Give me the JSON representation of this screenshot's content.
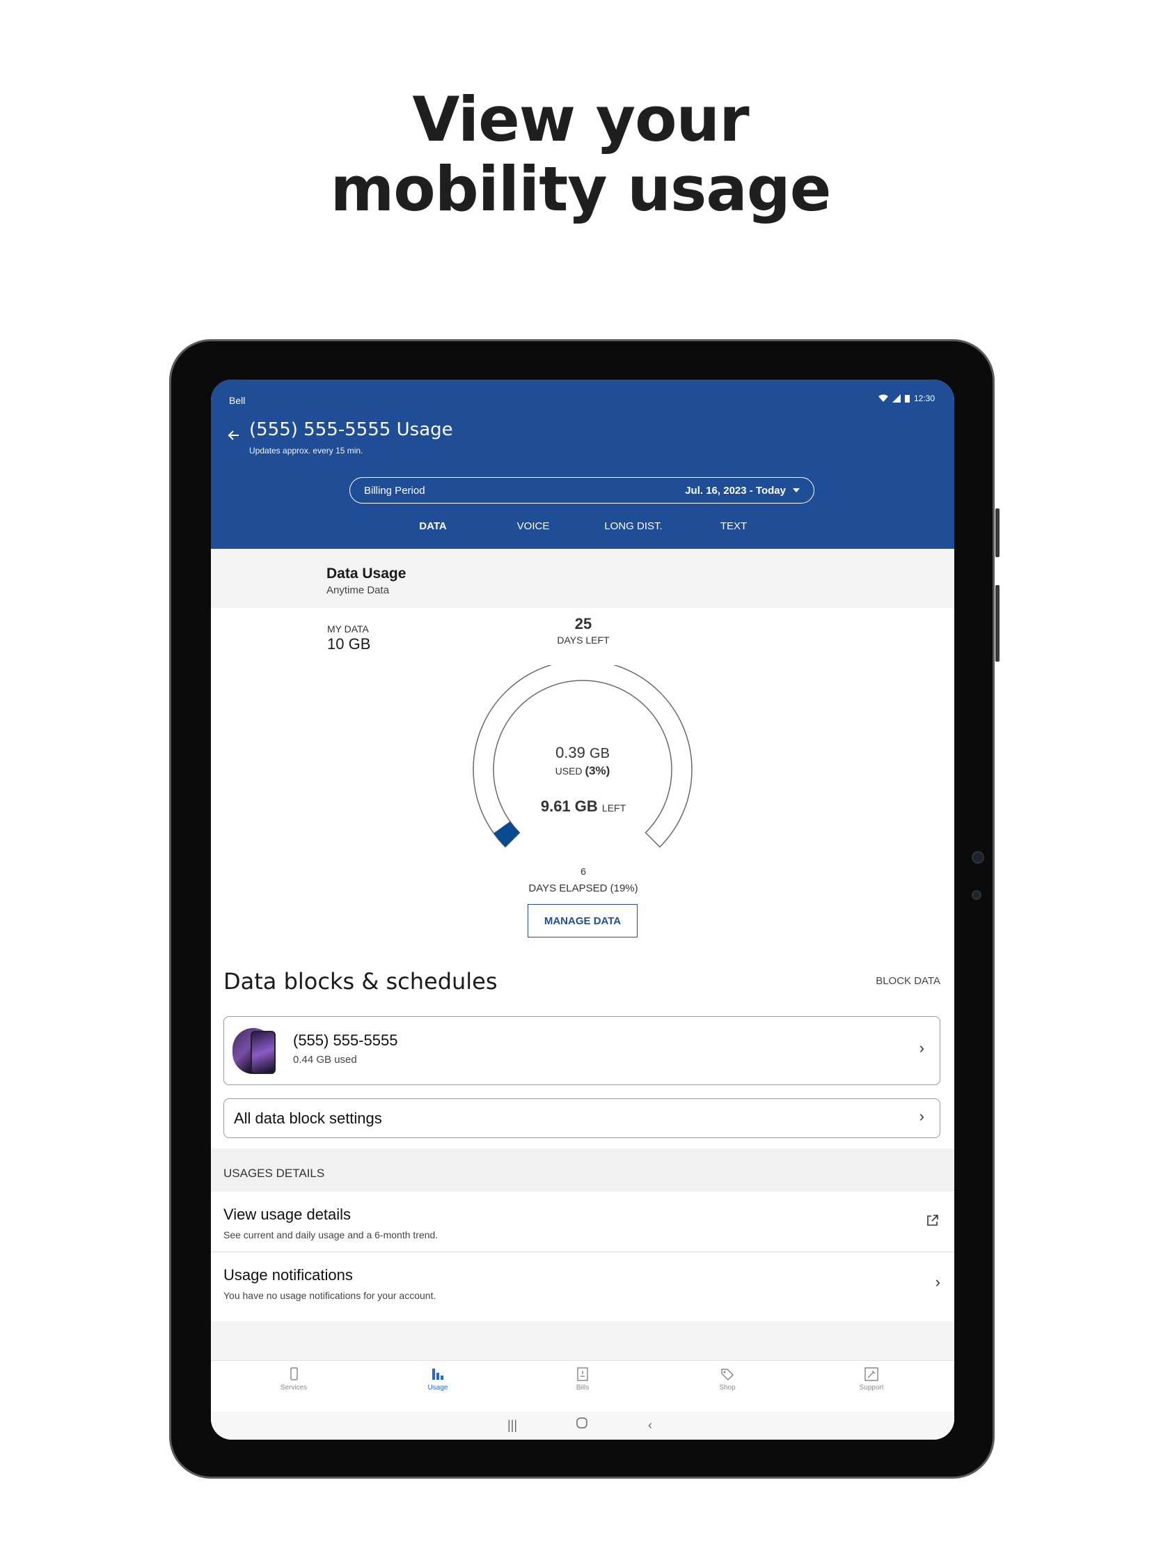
{
  "headline": {
    "line1": "View your",
    "line2": "mobility usage"
  },
  "status_bar": {
    "carrier": "Bell",
    "time": "12:30"
  },
  "header": {
    "title": "(555) 555-5555 Usage",
    "subtitle": "Updates approx. every 15 min.",
    "billing_label": "Billing Period",
    "billing_value": "Jul. 16, 2023 - Today"
  },
  "tabs": [
    "DATA",
    "VOICE",
    "LONG DIST.",
    "TEXT"
  ],
  "usage": {
    "title": "Data Usage",
    "subtitle": "Anytime Data",
    "my_data_label": "MY DATA",
    "my_data_value": "10 GB",
    "days_left_value": "25",
    "days_left_label": "DAYS LEFT",
    "used_value": "0.39",
    "used_unit": "GB",
    "used_label": "USED",
    "used_percent": "(3%)",
    "used_fraction": 0.03,
    "left_value": "9.61 GB",
    "left_label": "LEFT",
    "days_elapsed_value": "6",
    "days_elapsed_label": "DAYS ELAPSED (19%)",
    "manage_button": "MANAGE DATA",
    "accent_color": "#0a4a91"
  },
  "blocks": {
    "title": "Data blocks & schedules",
    "action": "BLOCK DATA",
    "line_number": "(555) 555-5555",
    "line_used": "0.44 GB used",
    "settings_label": "All data block settings"
  },
  "details": {
    "header": "USAGES DETAILS",
    "rows": [
      {
        "title": "View usage details",
        "subtitle": "See current and daily usage and a 6-month trend.",
        "icon": "external-link-icon"
      },
      {
        "title": "Usage notifications",
        "subtitle": "You have no usage notifications for your account.",
        "icon": "chevron-right-icon"
      }
    ]
  },
  "bottom_nav": [
    {
      "label": "Services",
      "icon": "phone-icon"
    },
    {
      "label": "Usage",
      "icon": "bar-chart-icon",
      "active": true
    },
    {
      "label": "Bills",
      "icon": "bill-icon"
    },
    {
      "label": "Shop",
      "icon": "tag-icon"
    },
    {
      "label": "Support",
      "icon": "support-icon"
    }
  ],
  "colors": {
    "header_bg": "#1f4e96",
    "nav_active": "#2268d8"
  }
}
